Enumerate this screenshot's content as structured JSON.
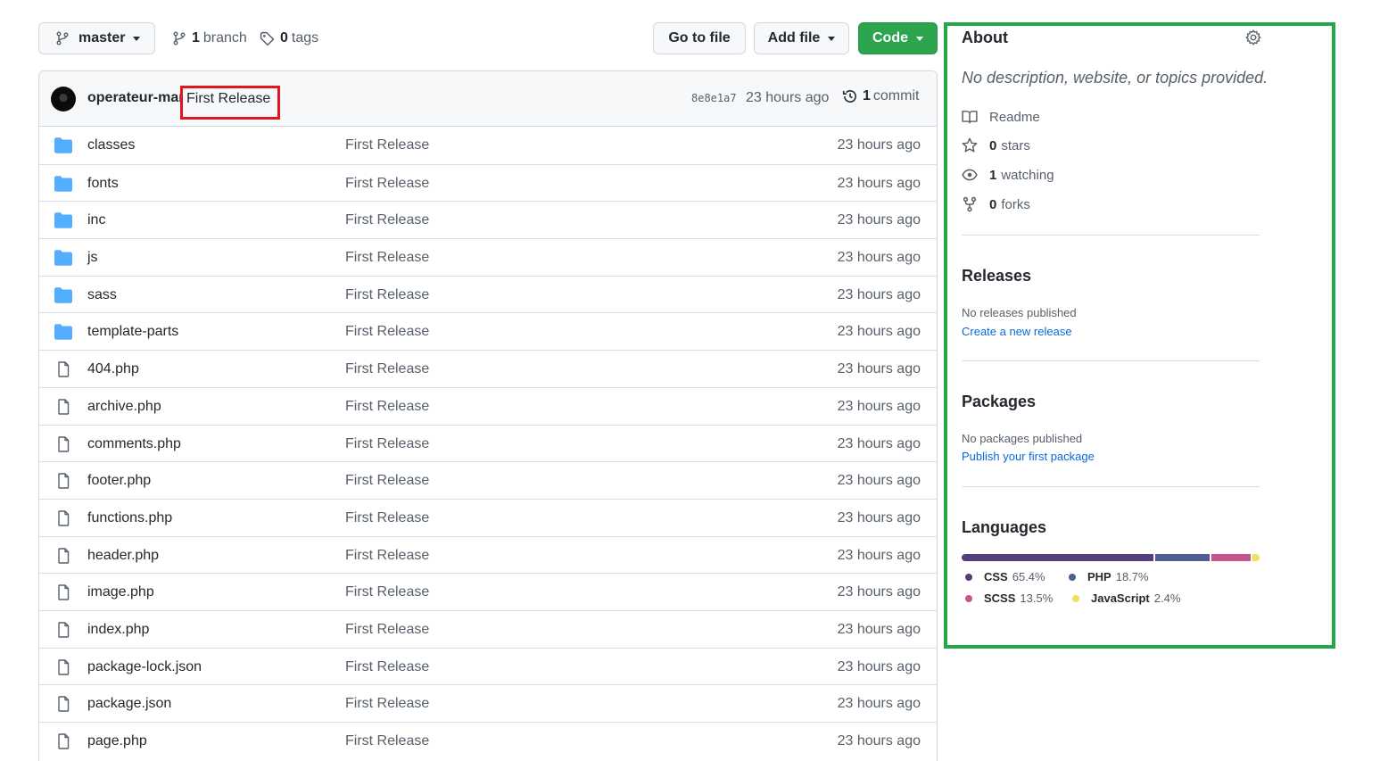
{
  "toolbar": {
    "branch_name": "master",
    "branch_count": "1",
    "branch_label": "branch",
    "tag_count": "0",
    "tag_label": "tags",
    "go_to_file": "Go to file",
    "add_file": "Add file",
    "code": "Code"
  },
  "commit": {
    "author": "operateur-mar",
    "message": "First Release",
    "sha": "8e8e1a7",
    "age": "23 hours ago",
    "count": "1",
    "count_label": "commit"
  },
  "files": [
    {
      "type": "dir",
      "name": "classes",
      "message": "First Release",
      "age": "23 hours ago"
    },
    {
      "type": "dir",
      "name": "fonts",
      "message": "First Release",
      "age": "23 hours ago"
    },
    {
      "type": "dir",
      "name": "inc",
      "message": "First Release",
      "age": "23 hours ago"
    },
    {
      "type": "dir",
      "name": "js",
      "message": "First Release",
      "age": "23 hours ago"
    },
    {
      "type": "dir",
      "name": "sass",
      "message": "First Release",
      "age": "23 hours ago"
    },
    {
      "type": "dir",
      "name": "template-parts",
      "message": "First Release",
      "age": "23 hours ago"
    },
    {
      "type": "file",
      "name": "404.php",
      "message": "First Release",
      "age": "23 hours ago"
    },
    {
      "type": "file",
      "name": "archive.php",
      "message": "First Release",
      "age": "23 hours ago"
    },
    {
      "type": "file",
      "name": "comments.php",
      "message": "First Release",
      "age": "23 hours ago"
    },
    {
      "type": "file",
      "name": "footer.php",
      "message": "First Release",
      "age": "23 hours ago"
    },
    {
      "type": "file",
      "name": "functions.php",
      "message": "First Release",
      "age": "23 hours ago"
    },
    {
      "type": "file",
      "name": "header.php",
      "message": "First Release",
      "age": "23 hours ago"
    },
    {
      "type": "file",
      "name": "image.php",
      "message": "First Release",
      "age": "23 hours ago"
    },
    {
      "type": "file",
      "name": "index.php",
      "message": "First Release",
      "age": "23 hours ago"
    },
    {
      "type": "file",
      "name": "package-lock.json",
      "message": "First Release",
      "age": "23 hours ago"
    },
    {
      "type": "file",
      "name": "package.json",
      "message": "First Release",
      "age": "23 hours ago"
    },
    {
      "type": "file",
      "name": "page.php",
      "message": "First Release",
      "age": "23 hours ago"
    }
  ],
  "about": {
    "title": "About",
    "description": "No description, website, or topics provided.",
    "readme": "Readme",
    "stars_count": "0",
    "stars_label": "stars",
    "watching_count": "1",
    "watching_label": "watching",
    "forks_count": "0",
    "forks_label": "forks"
  },
  "releases": {
    "title": "Releases",
    "empty": "No releases published",
    "link": "Create a new release"
  },
  "packages": {
    "title": "Packages",
    "empty": "No packages published",
    "link": "Publish your first package"
  },
  "languages": {
    "title": "Languages",
    "items": [
      {
        "name": "CSS",
        "percent": "65.4%",
        "value": 65.4,
        "color": "#563d7c"
      },
      {
        "name": "PHP",
        "percent": "18.7%",
        "value": 18.7,
        "color": "#4f5d95"
      },
      {
        "name": "SCSS",
        "percent": "13.5%",
        "value": 13.5,
        "color": "#c6538c"
      },
      {
        "name": "JavaScript",
        "percent": "2.4%",
        "value": 2.4,
        "color": "#f1e05a"
      }
    ]
  },
  "colors": {
    "primary_button": "#2da44e",
    "link": "#0969da",
    "highlight_red": "#e0161e",
    "highlight_green": "#22a846",
    "folder": "#54aeff"
  }
}
